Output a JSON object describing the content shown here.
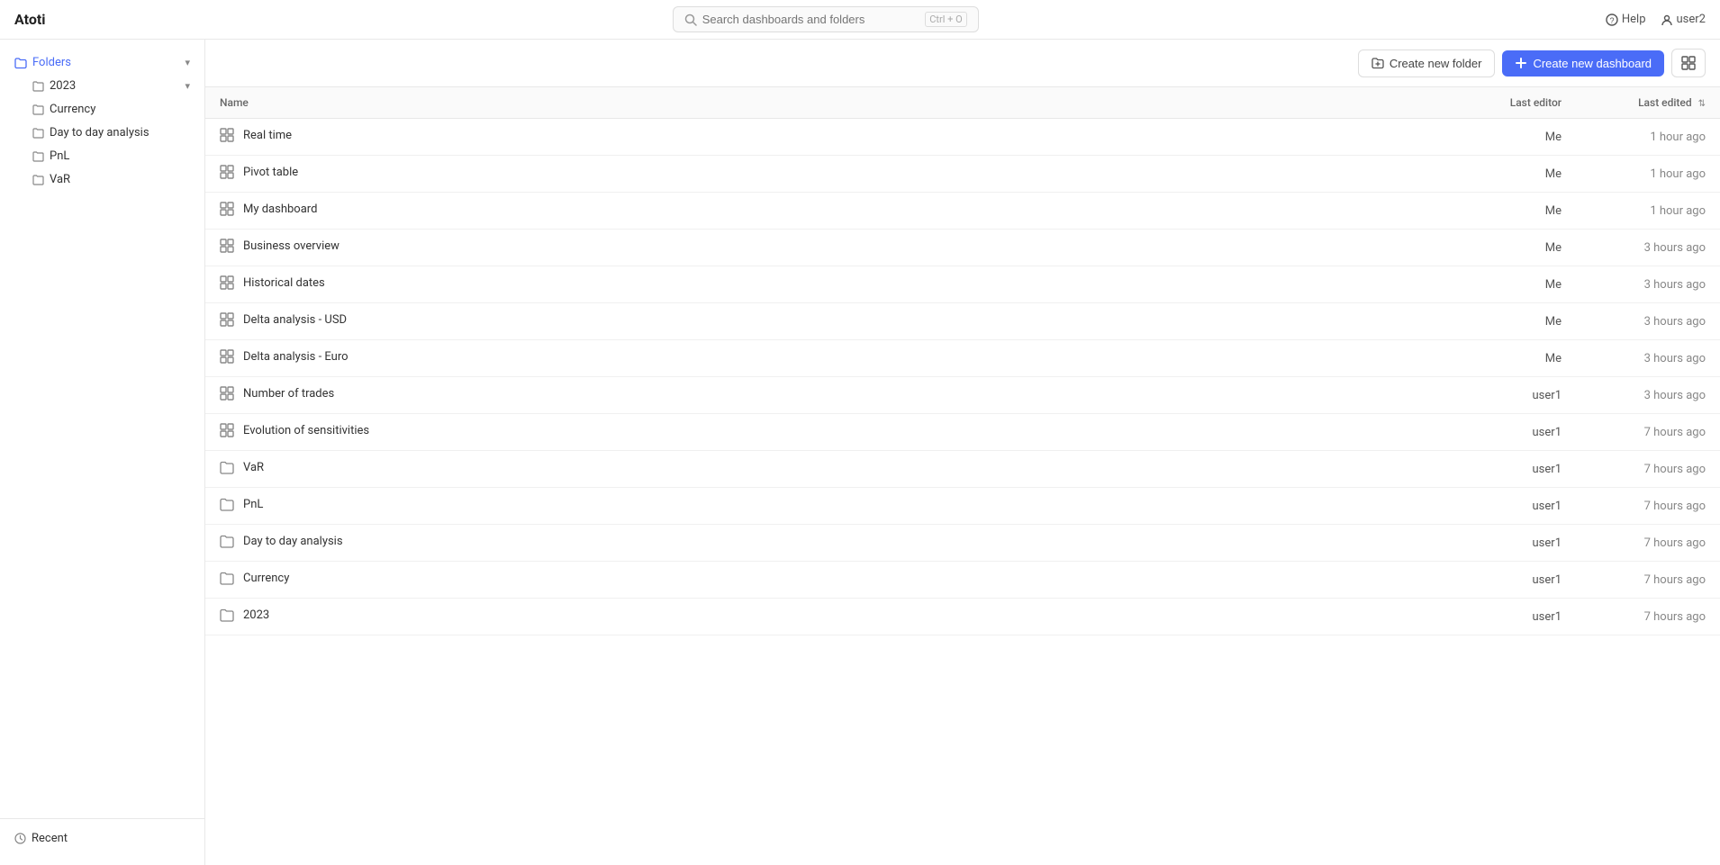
{
  "app": {
    "logo": "Atoti"
  },
  "topbar": {
    "search_placeholder": "Search dashboards and folders",
    "search_shortcut": "Ctrl + O",
    "help_label": "Help",
    "user_label": "user2"
  },
  "sidebar": {
    "folders_label": "Folders",
    "folder_2023": "2023",
    "sub_items": [
      {
        "label": "Currency",
        "type": "folder"
      },
      {
        "label": "Day to day analysis",
        "type": "folder"
      },
      {
        "label": "PnL",
        "type": "folder"
      },
      {
        "label": "VaR",
        "type": "folder"
      }
    ],
    "recent_label": "Recent"
  },
  "content_header": {
    "create_folder_label": "Create new folder",
    "create_dashboard_label": "Create new dashboard"
  },
  "table": {
    "columns": [
      {
        "key": "name",
        "label": "Name",
        "sortable": false
      },
      {
        "key": "last_editor",
        "label": "Last editor",
        "sortable": false
      },
      {
        "key": "last_edited",
        "label": "Last edited",
        "sortable": true
      }
    ],
    "rows": [
      {
        "name": "Real time",
        "type": "dashboard",
        "last_editor": "Me",
        "last_edited": "1 hour ago"
      },
      {
        "name": "Pivot table",
        "type": "dashboard",
        "last_editor": "Me",
        "last_edited": "1 hour ago"
      },
      {
        "name": "My dashboard",
        "type": "dashboard",
        "last_editor": "Me",
        "last_edited": "1 hour ago"
      },
      {
        "name": "Business overview",
        "type": "dashboard",
        "last_editor": "Me",
        "last_edited": "3 hours ago"
      },
      {
        "name": "Historical dates",
        "type": "dashboard",
        "last_editor": "Me",
        "last_edited": "3 hours ago"
      },
      {
        "name": "Delta analysis - USD",
        "type": "dashboard",
        "last_editor": "Me",
        "last_edited": "3 hours ago"
      },
      {
        "name": "Delta analysis - Euro",
        "type": "dashboard",
        "last_editor": "Me",
        "last_edited": "3 hours ago"
      },
      {
        "name": "Number of trades",
        "type": "dashboard",
        "last_editor": "user1",
        "last_edited": "3 hours ago"
      },
      {
        "name": "Evolution of sensitivities",
        "type": "dashboard",
        "last_editor": "user1",
        "last_edited": "7 hours ago"
      },
      {
        "name": "VaR",
        "type": "folder",
        "last_editor": "user1",
        "last_edited": "7 hours ago"
      },
      {
        "name": "PnL",
        "type": "folder",
        "last_editor": "user1",
        "last_edited": "7 hours ago"
      },
      {
        "name": "Day to day analysis",
        "type": "folder",
        "last_editor": "user1",
        "last_edited": "7 hours ago"
      },
      {
        "name": "Currency",
        "type": "folder",
        "last_editor": "user1",
        "last_edited": "7 hours ago"
      },
      {
        "name": "2023",
        "type": "folder",
        "last_editor": "user1",
        "last_edited": "7 hours ago"
      }
    ]
  }
}
